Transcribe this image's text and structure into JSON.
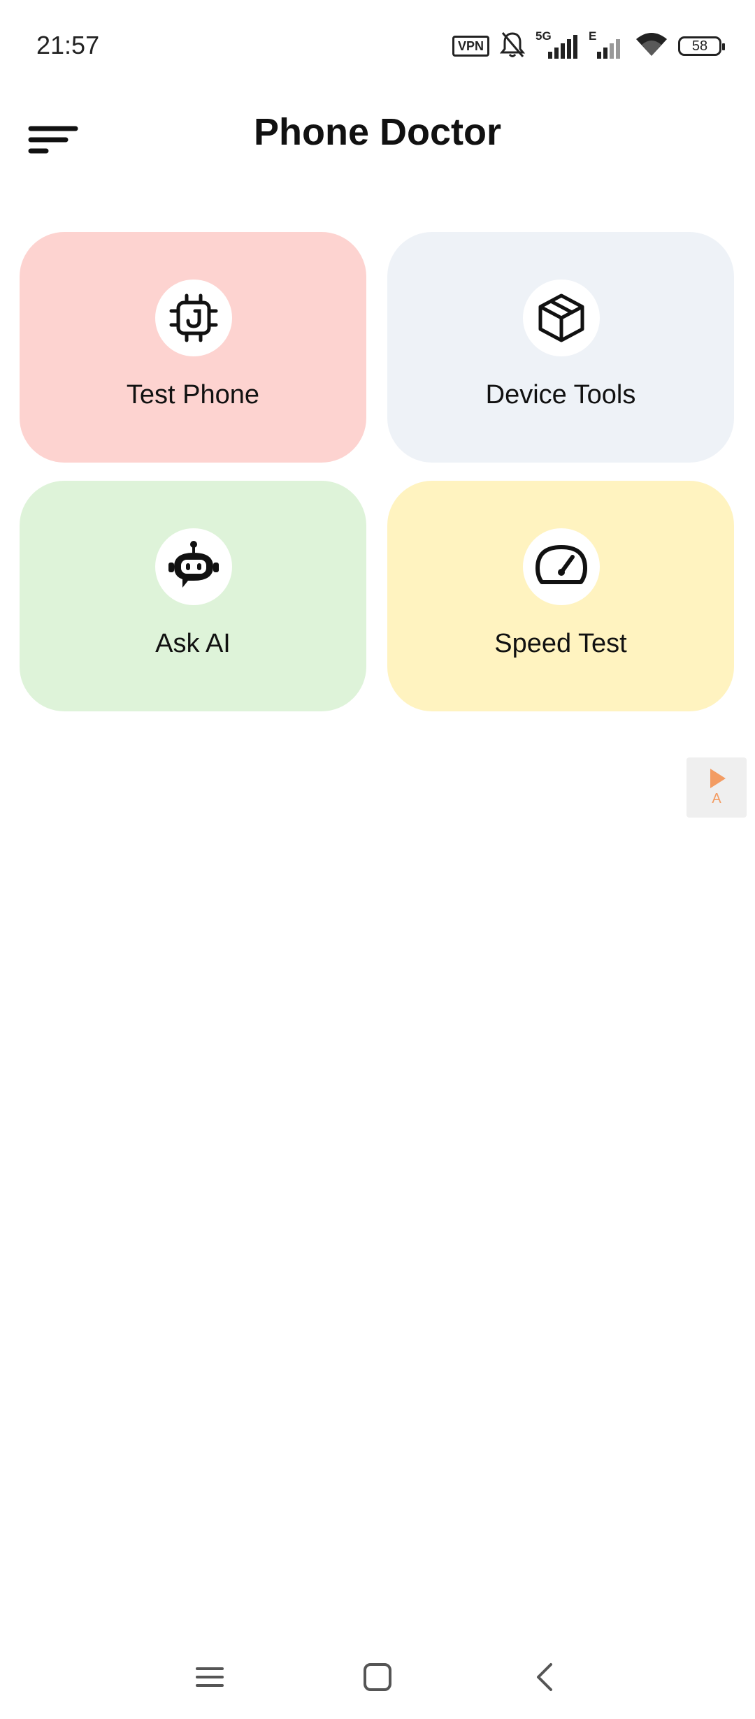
{
  "status_bar": {
    "time": "21:57",
    "vpn_label": "VPN",
    "network_5g": "5G",
    "network_e": "E",
    "battery": "58"
  },
  "app_bar": {
    "title": "Phone Doctor"
  },
  "cards": [
    {
      "label": "Test Phone",
      "icon": "chip-icon",
      "color": "#fdd3d0"
    },
    {
      "label": "Device Tools",
      "icon": "cube-icon",
      "color": "#eef2f7"
    },
    {
      "label": "Ask AI",
      "icon": "robot-icon",
      "color": "#def3d9"
    },
    {
      "label": "Speed Test",
      "icon": "speedometer-icon",
      "color": "#fff3c0"
    }
  ],
  "floating_ad": {
    "letter": "A",
    "accent": "#f39c63"
  },
  "nav_bar": {
    "items": [
      "menu-lines-icon",
      "home-square-icon",
      "back-chevron-icon"
    ]
  }
}
